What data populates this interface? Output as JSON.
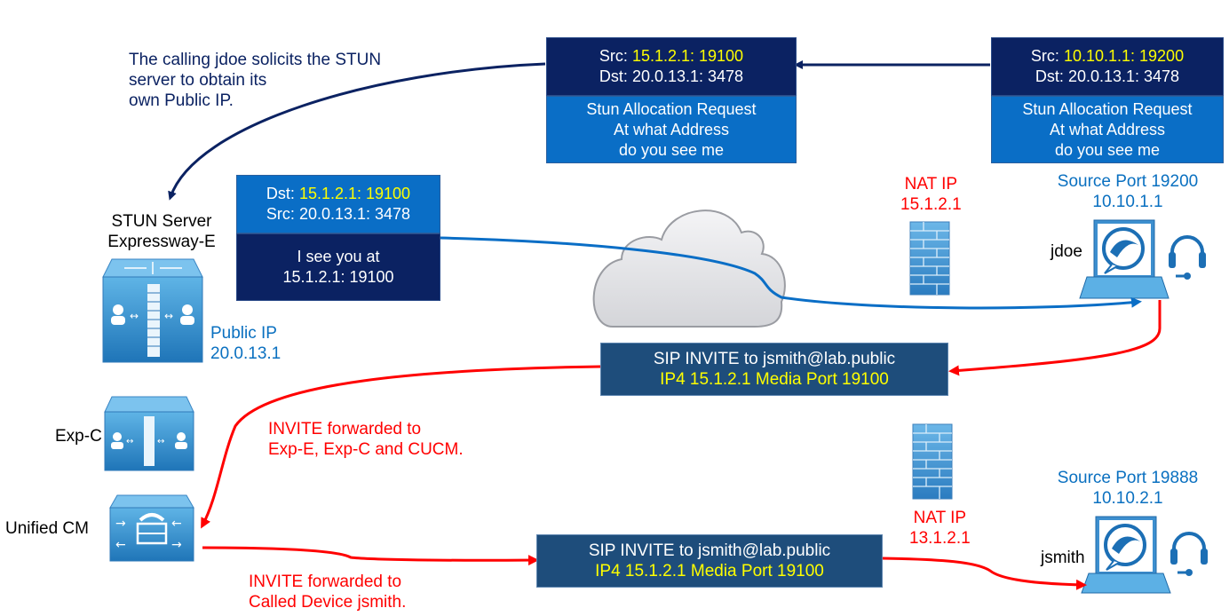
{
  "caption": {
    "lines": [
      "The calling jdoe solicits the STUN",
      "server to obtain its",
      "own Public IP."
    ]
  },
  "stun_request_nat": {
    "src_label": "Src:",
    "src_value": "15.1.2.1: 19100",
    "dst_label": "Dst:",
    "dst_value": "20.0.13.1: 3478",
    "body_lines": [
      "Stun Allocation Request",
      "At what Address",
      "do you see me"
    ]
  },
  "stun_request_client": {
    "src_label": "Src:",
    "src_value": "10.10.1.1: 19200",
    "dst_label": "Dst:",
    "dst_value": "20.0.13.1: 3478",
    "body_lines": [
      "Stun Allocation Request",
      "At what Address",
      "do you see me"
    ]
  },
  "stun_response": {
    "dst_label": "Dst:",
    "dst_value": "15.1.2.1: 19100",
    "src_label": "Src:",
    "src_value": "20.0.13.1: 3478",
    "body_lines": [
      "I see you at",
      "15.1.2.1: 19100"
    ]
  },
  "stun_server": {
    "name_lines": [
      "STUN Server",
      "Expressway-E"
    ],
    "public_ip_label": "Public IP",
    "public_ip": "20.0.13.1"
  },
  "exp_c": {
    "label": "Exp-C"
  },
  "unified_cm": {
    "label": "Unified CM"
  },
  "nat_top": {
    "label": "NAT IP",
    "ip": "15.1.2.1"
  },
  "nat_bottom": {
    "label": "NAT IP",
    "ip": "13.1.2.1"
  },
  "jdoe": {
    "name": "jdoe",
    "source_port": "Source Port 19200",
    "ip": "10.10.1.1"
  },
  "jsmith": {
    "name": "jsmith",
    "source_port": "Source Port 19888",
    "ip": "10.10.2.1"
  },
  "sip_invite_top": {
    "line1": "SIP INVITE to jsmith@lab.public",
    "line2": "IP4 15.1.2.1 Media Port 19100"
  },
  "sip_invite_bottom": {
    "line1": "SIP INVITE to jsmith@lab.public",
    "line2": "IP4 15.1.2.1 Media Port 19100"
  },
  "note_forward_1": {
    "lines": [
      "INVITE forwarded to",
      "Exp-E, Exp-C and CUCM."
    ]
  },
  "note_forward_2": {
    "lines": [
      "INVITE forwarded to",
      "Called Device jsmith."
    ]
  },
  "colors": {
    "stun_flow": "#0b2262",
    "response_flow": "#0a6ec6",
    "sip_flow": "#ff0000",
    "highlight": "#ffff00"
  }
}
